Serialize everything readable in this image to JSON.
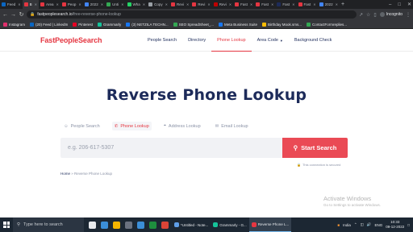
{
  "browser": {
    "tabs": [
      {
        "label": "Feed",
        "color": "#0a66c2",
        "active": false
      },
      {
        "label": "B",
        "color": "#e53641",
        "active": true
      },
      {
        "label": "Area",
        "color": "#e53641",
        "active": false
      },
      {
        "label": "Peop",
        "color": "#e53641",
        "active": false
      },
      {
        "label": "2022",
        "color": "#4285f4",
        "active": false
      },
      {
        "label": "Unti",
        "color": "#34a853",
        "active": false
      },
      {
        "label": "Wha",
        "color": "#25d366",
        "active": false
      },
      {
        "label": "Copy",
        "color": "#9aa0a6",
        "active": false
      },
      {
        "label": "Revi",
        "color": "#e53641",
        "active": false
      },
      {
        "label": "Revi",
        "color": "#e53641",
        "active": false
      },
      {
        "label": "Revi",
        "color": "#c00000",
        "active": false
      },
      {
        "label": "Fast",
        "color": "#e53641",
        "active": false
      },
      {
        "label": "Fast",
        "color": "#e53641",
        "active": false
      },
      {
        "label": "Fast",
        "color": "#1d2b5a",
        "active": false
      },
      {
        "label": "Fast",
        "color": "#e53641",
        "active": false
      },
      {
        "label": "2022",
        "color": "#4285f4",
        "active": false
      }
    ],
    "url_domain": "fastpeoplesearch.io",
    "url_path": "/free-reverse-phone-lookup",
    "profile_label": "Incognito",
    "bookmarks": [
      {
        "label": "Instagram",
        "color": "#e1306c"
      },
      {
        "label": "(20) Feed | LinkedIn",
        "color": "#0a66c2"
      },
      {
        "label": "Pinterest",
        "color": "#e60023"
      },
      {
        "label": "Grammarly",
        "color": "#15c39a"
      },
      {
        "label": "(3) NETZILA TECHN...",
        "color": "#1877f2"
      },
      {
        "label": "SEO SpreadSheet_...",
        "color": "#34a853"
      },
      {
        "label": "Meta Business Suite",
        "color": "#1877f2"
      },
      {
        "label": "Birthday Mook.sms...",
        "color": "#fbbc05"
      },
      {
        "label": "ContactFormreplies...",
        "color": "#34a853"
      }
    ]
  },
  "site": {
    "logo": "FastPeopleSearch",
    "nav": [
      {
        "label": "People Search",
        "active": false
      },
      {
        "label": "Directory",
        "active": false
      },
      {
        "label": "Phone Lookup",
        "active": true
      },
      {
        "label": "Area Code",
        "active": false,
        "dropdown": true
      },
      {
        "label": "Background Check",
        "active": false
      }
    ]
  },
  "main": {
    "title": "Reverse Phone Lookup",
    "search_tabs": [
      {
        "label": "People Search",
        "icon": "person-icon",
        "active": false
      },
      {
        "label": "Phone Lookup",
        "icon": "phone-icon",
        "active": true
      },
      {
        "label": "Address Lookup",
        "icon": "location-icon",
        "active": false
      },
      {
        "label": "Email Lookup",
        "icon": "email-icon",
        "active": false
      }
    ],
    "phone_placeholder": "e.g. 206-617-5307",
    "search_button": "Start Search",
    "secure_note": "This connection is secured",
    "breadcrumb_home": "Home",
    "breadcrumb_sep": " » ",
    "breadcrumb_current": "Reverse Phone Lookup"
  },
  "watermark": {
    "heading": "Activate Windows",
    "subtext": "Go to Settings to activate Windows."
  },
  "taskbar": {
    "search_placeholder": "Type here to search",
    "apps": [
      {
        "label": "*Untitled - Note...",
        "color": "#5f9ee8",
        "active": false
      },
      {
        "label": "Grammarly - G...",
        "color": "#15c39a",
        "active": false
      },
      {
        "label": "Reverse Phone L...",
        "color": "#e53641",
        "active": true
      }
    ],
    "tray_label": "India",
    "lang": "ENG",
    "time": "10:33",
    "date": "09-12-2022"
  },
  "colors": {
    "brand": "#e53641",
    "navy": "#1d2b5a"
  }
}
